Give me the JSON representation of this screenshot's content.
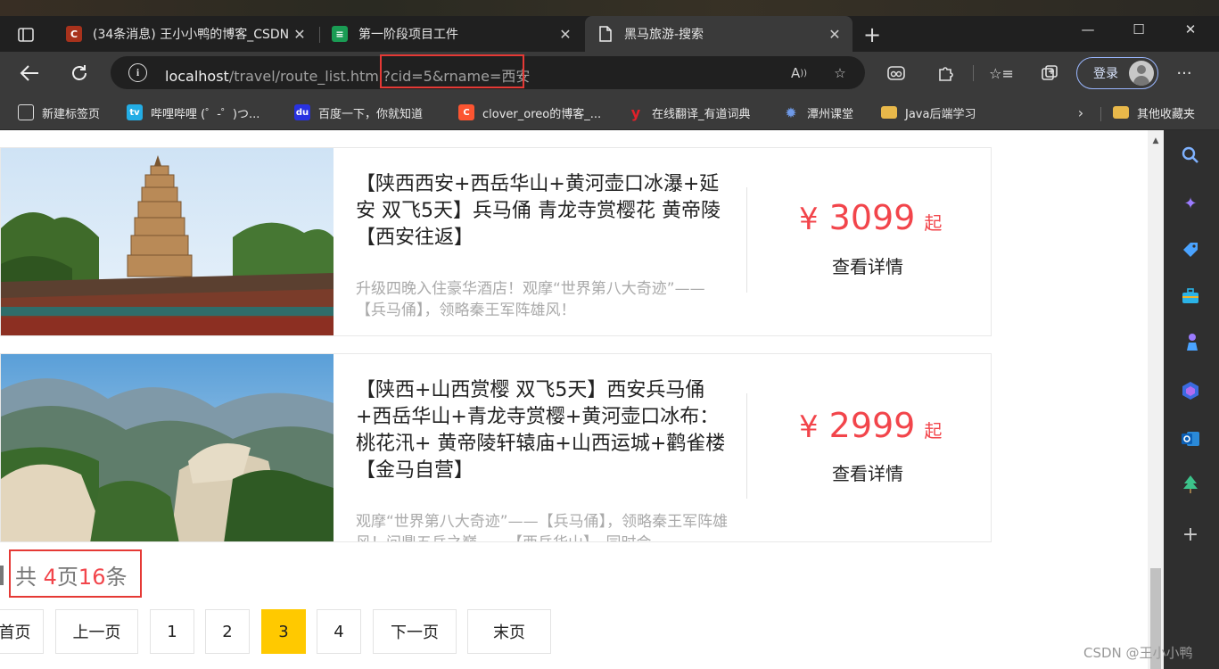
{
  "browser": {
    "tabs": [
      {
        "title": "(34条消息) 王小小鸭的博客_CSDN",
        "favicon": "C",
        "favicon_color": "#a8321c",
        "active": false
      },
      {
        "title": "第一阶段项目工件",
        "favicon": "≡",
        "favicon_color": "#1a9c54",
        "active": false
      },
      {
        "title": "黑马旅游-搜索",
        "favicon": "page-icon",
        "favicon_color": "#3a3a3a",
        "active": true
      }
    ],
    "new_tab": "+",
    "window_controls": {
      "minimize": "—",
      "maximize": "☐",
      "close": "✕"
    },
    "url": {
      "host": "localhost",
      "path": "/travel/route_list.html?",
      "query": "cid=5&rname=西安"
    },
    "login_label": "登录",
    "more": "···",
    "bookmarks": [
      {
        "label": "新建标签页",
        "icon": "tab-icon",
        "color": "#555555"
      },
      {
        "label": "哔哩哔哩 (゜-゜)つ...",
        "icon": "bilibili-icon",
        "color": "#23ade5"
      },
      {
        "label": "百度一下，你就知道",
        "icon": "baidu-icon",
        "color": "#2932e1"
      },
      {
        "label": "clover_oreo的博客_...",
        "icon": "csdn-icon",
        "color": "#fc5531"
      },
      {
        "label": "在线翻译_有道词典",
        "icon": "youdao-icon",
        "color": "#e0202a"
      },
      {
        "label": "潭州课堂",
        "icon": "gear-icon",
        "color": "#4a7bd6"
      },
      {
        "label": "Java后端学习",
        "icon": "folder-icon",
        "color": "#e8b84a"
      }
    ],
    "other_bookmarks": "其他收藏夹"
  },
  "routes": [
    {
      "title": "【陕西西安+西岳华山+黄河壶口冰瀑+延安 双飞5天】兵马俑 青龙寺赏樱花 黄帝陵【西安往返】",
      "desc": "升级四晚入住豪华酒店！观摩“世界第八大奇迹”——【兵马俑】，领略秦王军阵雄风！",
      "price_symbol": "¥",
      "price": "3099",
      "price_suffix": "起",
      "detail_label": "查看详情",
      "image": "pagoda-photo"
    },
    {
      "title": "【陕西+山西赏樱 双飞5天】西安兵马俑+西岳华山+青龙寺赏樱+黄河壶口冰布：桃花汛+ 黄帝陵轩辕庙+山西运城+鹳雀楼【金马自营】",
      "desc": "观摩“世界第八大奇迹”——【兵马俑】，领略秦王军阵雄风！问鼎五岳之巅——【西岳华山】，同时会",
      "price_symbol": "¥",
      "price": "2999",
      "price_suffix": "起",
      "detail_label": "查看详情",
      "image": "mountain-photo"
    }
  ],
  "summary": {
    "prefix": "共 ",
    "pages": "4",
    "mid": "页",
    "count": "16",
    "suffix": "条"
  },
  "pagination": [
    {
      "label": "首页",
      "active": false
    },
    {
      "label": "上一页",
      "active": false
    },
    {
      "label": "1",
      "active": false
    },
    {
      "label": "2",
      "active": false
    },
    {
      "label": "3",
      "active": true
    },
    {
      "label": "4",
      "active": false
    },
    {
      "label": "下一页",
      "active": false
    },
    {
      "label": "末页",
      "active": false
    }
  ],
  "watermark": "CSDN @王小小鸭",
  "colors": {
    "accent_price": "#f2454b",
    "active_page": "#ffc900",
    "highlight_box": "#e53935"
  }
}
